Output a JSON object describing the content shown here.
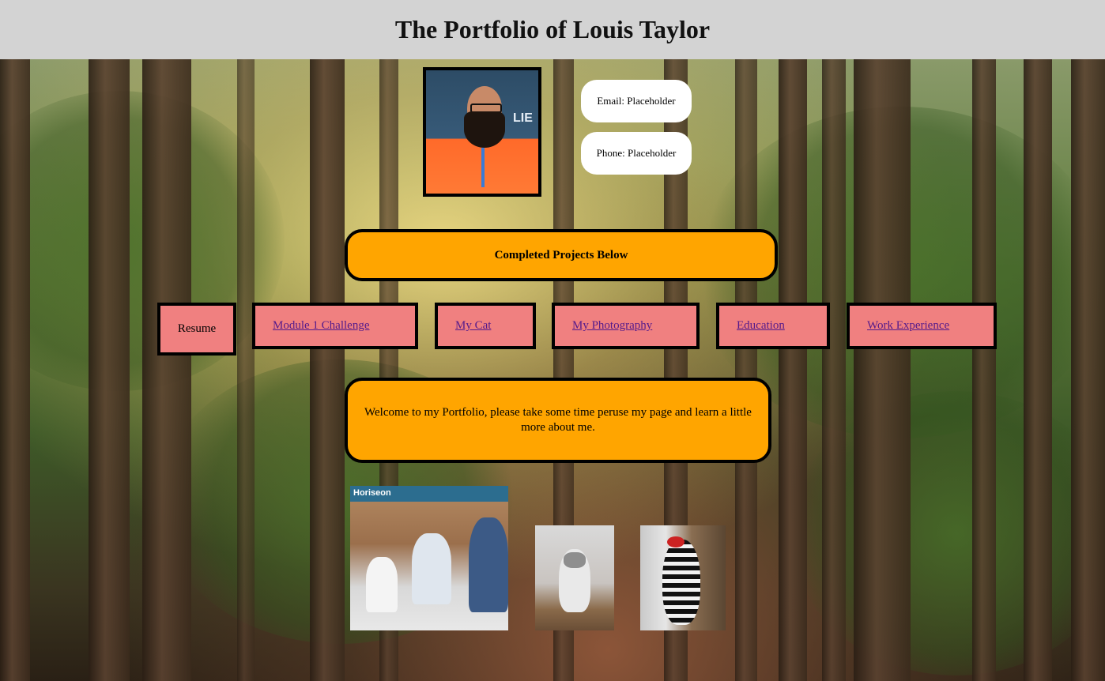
{
  "header": {
    "title": "The Portfolio of Louis Taylor"
  },
  "profile": {
    "badge_text": "LIE"
  },
  "contact": {
    "email": "Email: Placeholder",
    "phone": "Phone: Placeholder"
  },
  "section": {
    "heading": "Completed Projects Below"
  },
  "nav": {
    "items": [
      {
        "label": "Resume",
        "link": false
      },
      {
        "label": "Module 1 Challenge",
        "link": true
      },
      {
        "label": "My Cat",
        "link": true
      },
      {
        "label": "My Photography",
        "link": true
      },
      {
        "label": "Education",
        "link": true
      },
      {
        "label": "Work Experience",
        "link": true
      }
    ]
  },
  "welcome": {
    "text": "Welcome to my Portfolio, please take some time peruse my page and learn a little more about me."
  },
  "thumbnails": {
    "horiseon_brand": "Horiseon"
  },
  "colors": {
    "header_bg": "#d3d3d3",
    "accent_orange": "#ffa500",
    "nav_bg": "#f08080",
    "link": "#551a8b"
  }
}
